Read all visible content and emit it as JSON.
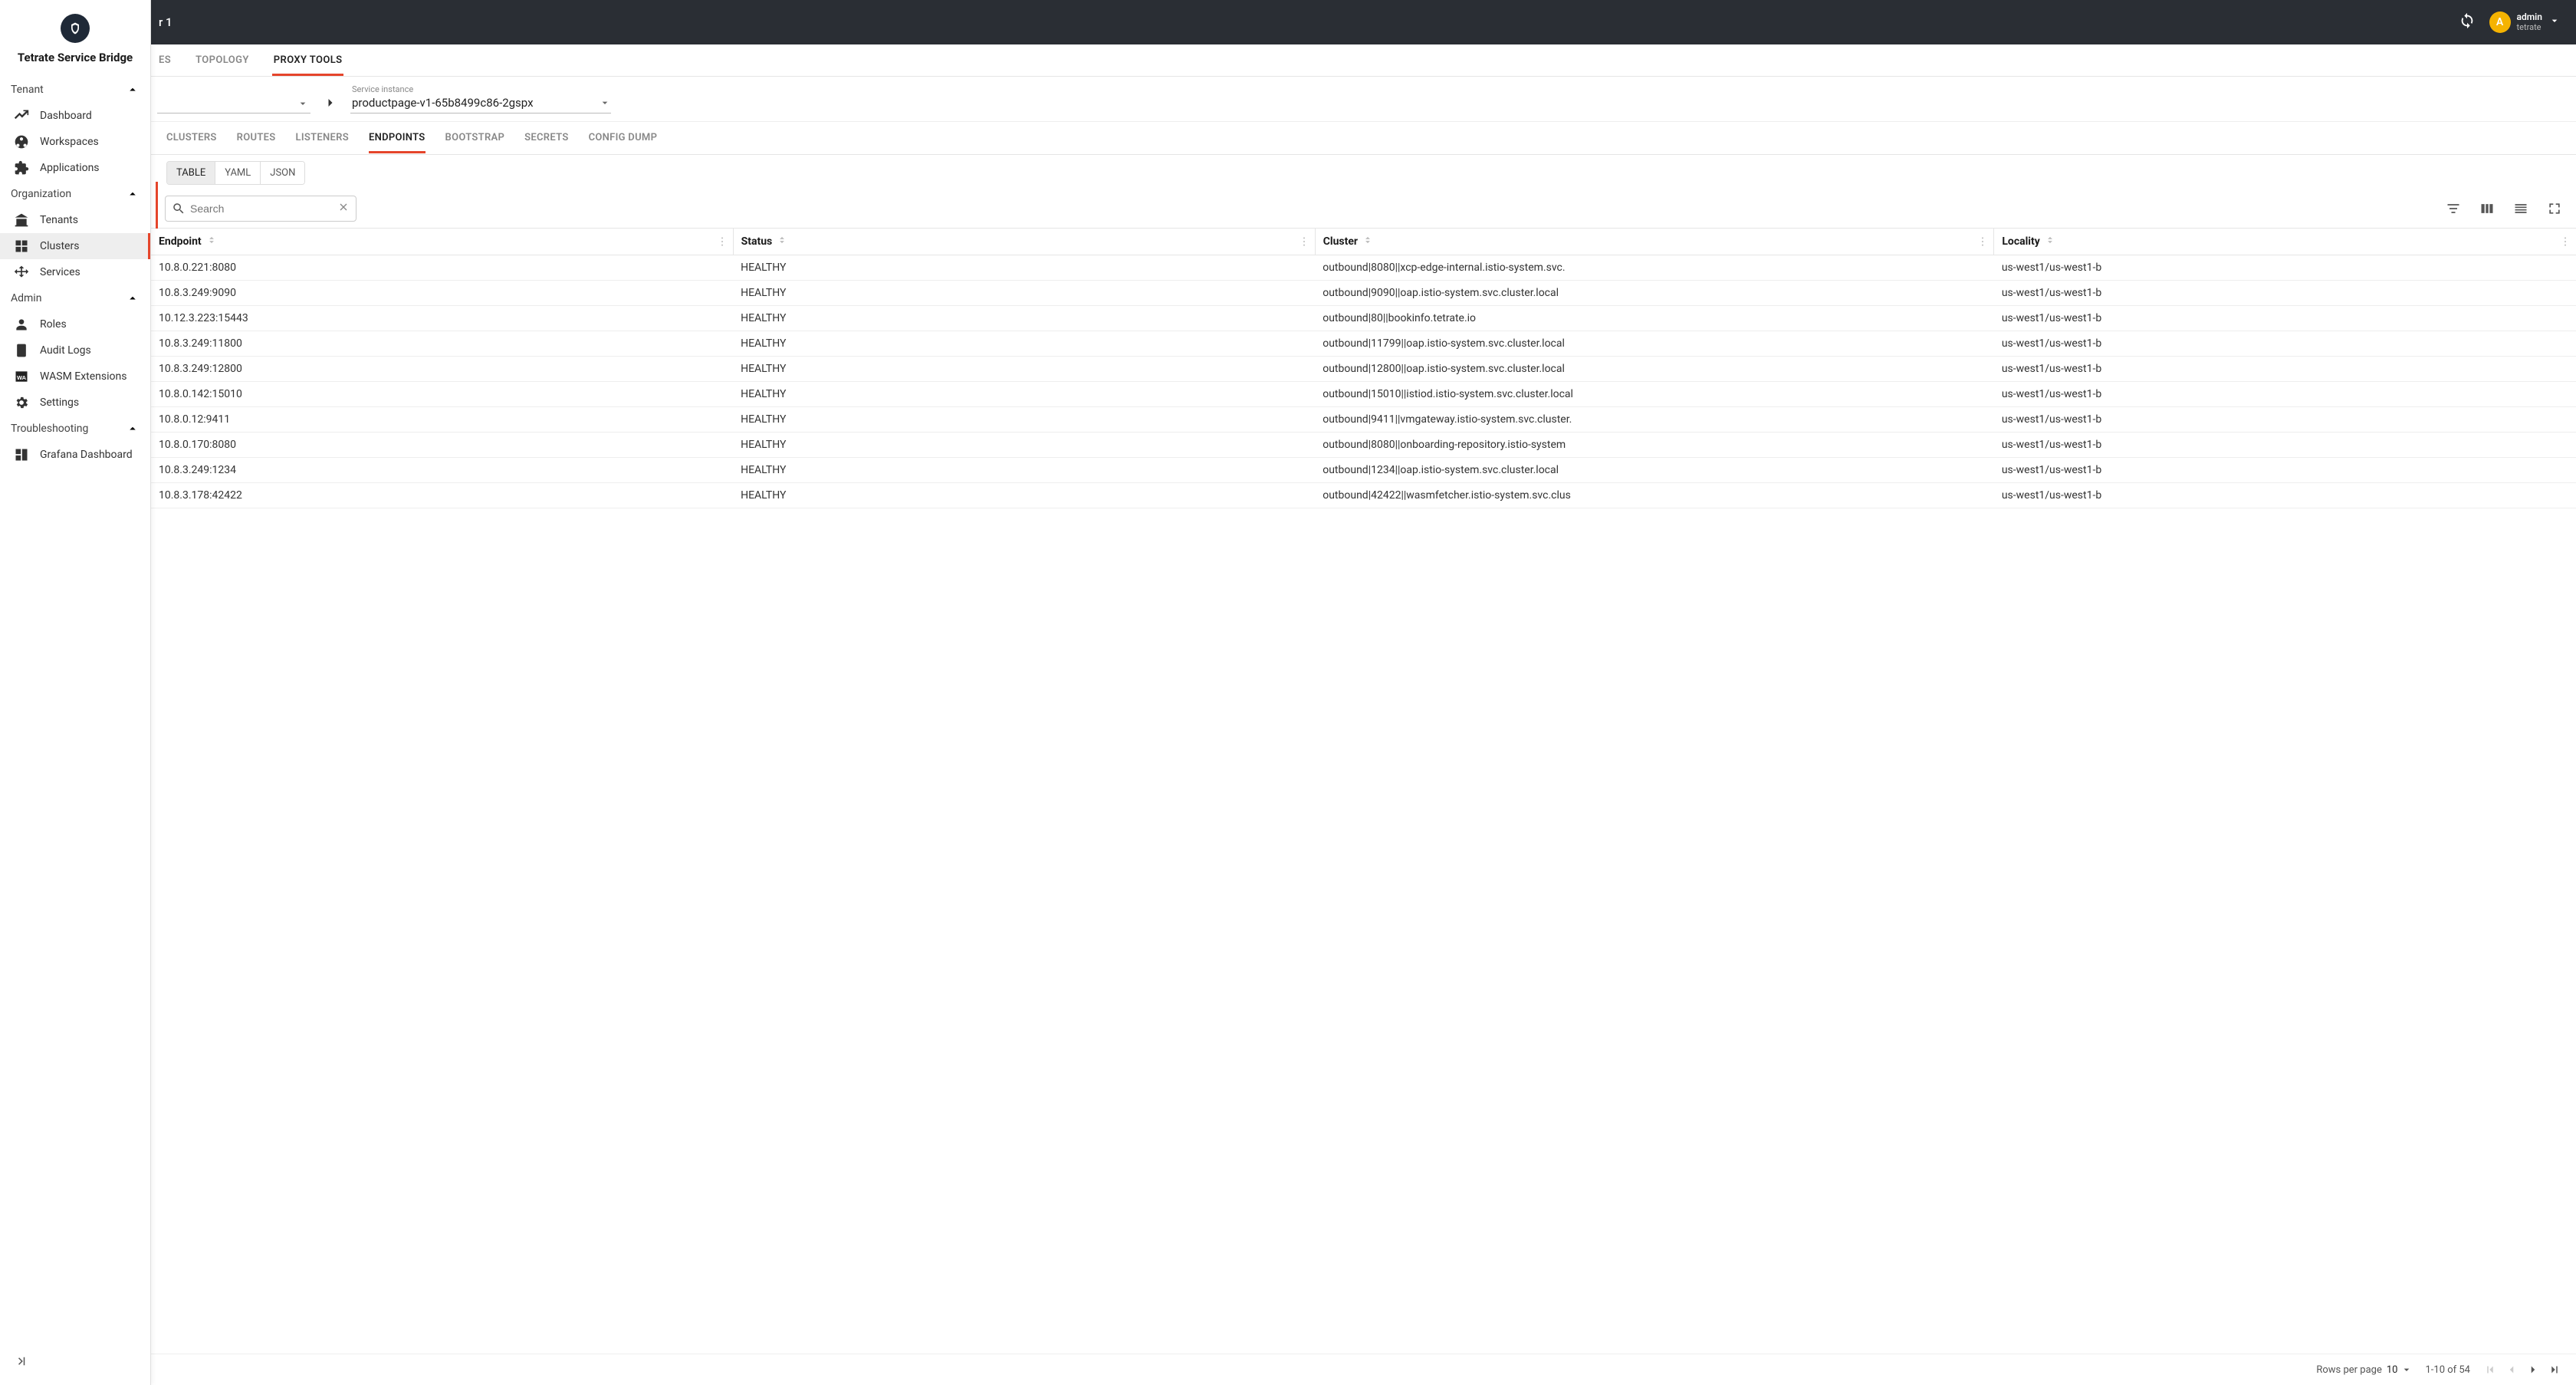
{
  "brand": "Tetrate Service Bridge",
  "topbar": {
    "title_suffix": "r 1",
    "user": {
      "initial": "A",
      "name": "admin",
      "org": "tetrate"
    }
  },
  "sidebar": {
    "groups": [
      {
        "label": "Tenant",
        "items": [
          {
            "label": "Dashboard",
            "icon": "dashboard"
          },
          {
            "label": "Workspaces",
            "icon": "workspaces"
          },
          {
            "label": "Applications",
            "icon": "applications"
          }
        ]
      },
      {
        "label": "Organization",
        "items": [
          {
            "label": "Tenants",
            "icon": "tenants"
          },
          {
            "label": "Clusters",
            "icon": "clusters",
            "active": true
          },
          {
            "label": "Services",
            "icon": "services"
          }
        ]
      },
      {
        "label": "Admin",
        "items": [
          {
            "label": "Roles",
            "icon": "roles"
          },
          {
            "label": "Audit Logs",
            "icon": "audit"
          },
          {
            "label": "WASM Extensions",
            "icon": "wasm"
          },
          {
            "label": "Settings",
            "icon": "settings"
          }
        ]
      },
      {
        "label": "Troubleshooting",
        "items": [
          {
            "label": "Grafana Dashboard",
            "icon": "grafana"
          }
        ]
      }
    ]
  },
  "main_tabs": {
    "partial_left": "ES",
    "items": [
      "TOPOLOGY",
      "PROXY TOOLS"
    ],
    "active": "PROXY TOOLS"
  },
  "selector": {
    "label": "Service instance",
    "value": "productpage-v1-65b8499c86-2gspx"
  },
  "subtabs": {
    "items": [
      "CLUSTERS",
      "ROUTES",
      "LISTENERS",
      "ENDPOINTS",
      "BOOTSTRAP",
      "SECRETS",
      "CONFIG DUMP"
    ],
    "active": "ENDPOINTS"
  },
  "format": {
    "options": [
      "TABLE",
      "YAML",
      "JSON"
    ],
    "active": "TABLE"
  },
  "search": {
    "placeholder": "Search"
  },
  "table": {
    "columns": [
      "Endpoint",
      "Status",
      "Cluster",
      "Locality"
    ],
    "rows": [
      {
        "endpoint": "10.8.0.221:8080",
        "status": "HEALTHY",
        "cluster": "outbound|8080||xcp-edge-internal.istio-system.svc.",
        "locality": "us-west1/us-west1-b"
      },
      {
        "endpoint": "10.8.3.249:9090",
        "status": "HEALTHY",
        "cluster": "outbound|9090||oap.istio-system.svc.cluster.local",
        "locality": "us-west1/us-west1-b"
      },
      {
        "endpoint": "10.12.3.223:15443",
        "status": "HEALTHY",
        "cluster": "outbound|80||bookinfo.tetrate.io",
        "locality": "us-west1/us-west1-b"
      },
      {
        "endpoint": "10.8.3.249:11800",
        "status": "HEALTHY",
        "cluster": "outbound|11799||oap.istio-system.svc.cluster.local",
        "locality": "us-west1/us-west1-b"
      },
      {
        "endpoint": "10.8.3.249:12800",
        "status": "HEALTHY",
        "cluster": "outbound|12800||oap.istio-system.svc.cluster.local",
        "locality": "us-west1/us-west1-b"
      },
      {
        "endpoint": "10.8.0.142:15010",
        "status": "HEALTHY",
        "cluster": "outbound|15010||istiod.istio-system.svc.cluster.local",
        "locality": "us-west1/us-west1-b"
      },
      {
        "endpoint": "10.8.0.12:9411",
        "status": "HEALTHY",
        "cluster": "outbound|9411||vmgateway.istio-system.svc.cluster.",
        "locality": "us-west1/us-west1-b"
      },
      {
        "endpoint": "10.8.0.170:8080",
        "status": "HEALTHY",
        "cluster": "outbound|8080||onboarding-repository.istio-system",
        "locality": "us-west1/us-west1-b"
      },
      {
        "endpoint": "10.8.3.249:1234",
        "status": "HEALTHY",
        "cluster": "outbound|1234||oap.istio-system.svc.cluster.local",
        "locality": "us-west1/us-west1-b"
      },
      {
        "endpoint": "10.8.3.178:42422",
        "status": "HEALTHY",
        "cluster": "outbound|42422||wasmfetcher.istio-system.svc.clus",
        "locality": "us-west1/us-west1-b"
      }
    ]
  },
  "pagination": {
    "rows_per_page_label": "Rows per page",
    "page_size": "10",
    "range": "1-10 of 54"
  }
}
